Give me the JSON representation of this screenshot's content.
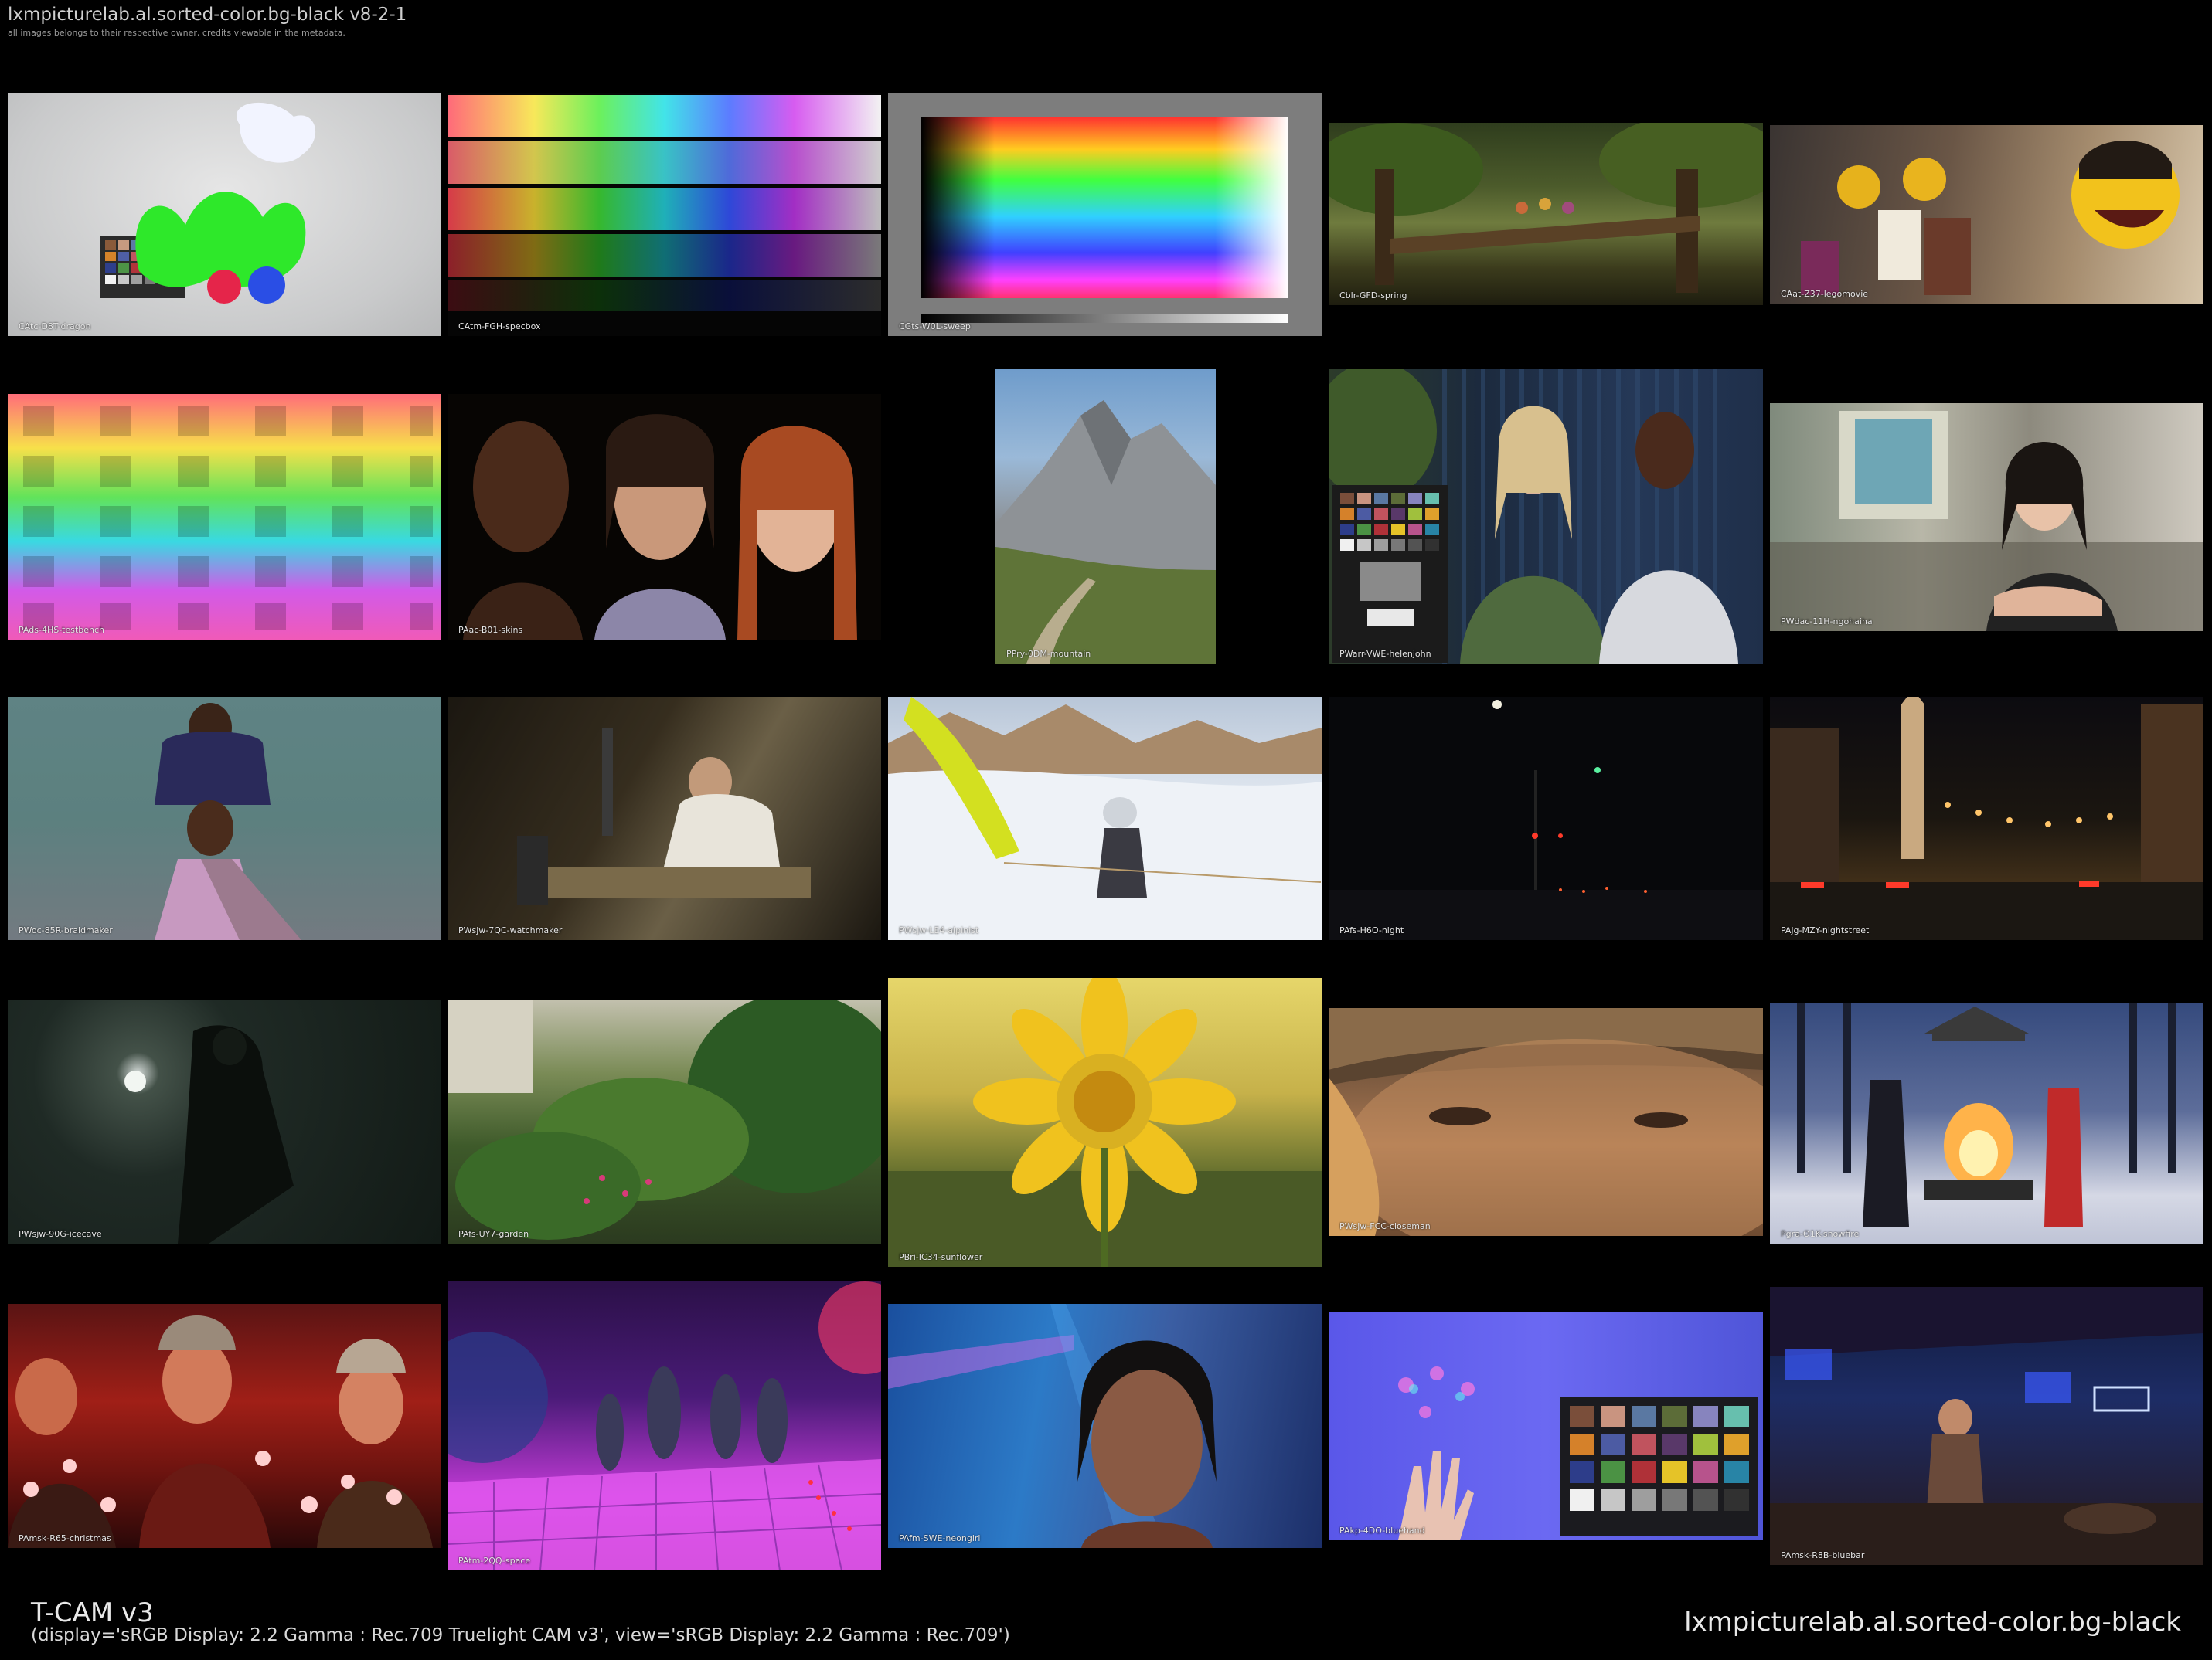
{
  "header": {
    "title": "lxmpicturelab.al.sorted-color.bg-black v8-2-1",
    "subtitle": "all images belongs to their respective owner, credits viewable in the metadata."
  },
  "tiles": [
    {
      "id": "dragon",
      "label": "CAtc-D8T-dragon"
    },
    {
      "id": "specbox",
      "label": "CAtm-FGH-specbox"
    },
    {
      "id": "sweep",
      "label": "CGts-W0L-sweep"
    },
    {
      "id": "spring",
      "label": "Cblr-GFD-spring"
    },
    {
      "id": "lego",
      "label": "CAat-Z37-legomovie"
    },
    {
      "id": "testbench",
      "label": "PAds-4HS-testbench"
    },
    {
      "id": "skins",
      "label": "PAac-B01-skins"
    },
    {
      "id": "mountain",
      "label": "PPry-0DM-mountain"
    },
    {
      "id": "helen",
      "label": "PWarr-VWE-helenjohn"
    },
    {
      "id": "ngo",
      "label": "PWdac-11H-ngohaiha"
    },
    {
      "id": "braid",
      "label": "PWoc-85R-braidmaker"
    },
    {
      "id": "watch",
      "label": "PWsjw-7QC-watchmaker"
    },
    {
      "id": "alpinist",
      "label": "PWsjw-LE4-alpinist"
    },
    {
      "id": "night",
      "label": "PAfs-H6O-night"
    },
    {
      "id": "nightstreet",
      "label": "PAjg-MZY-nightstreet"
    },
    {
      "id": "icecave",
      "label": "PWsjw-90G-icecave"
    },
    {
      "id": "garden",
      "label": "PAfs-UY7-garden"
    },
    {
      "id": "sunflower",
      "label": "PBri-IC34-sunflower"
    },
    {
      "id": "closeman",
      "label": "PWsjw-FCC-closeman"
    },
    {
      "id": "snowfire",
      "label": "Pgra-O1K-snowfire"
    },
    {
      "id": "christmas",
      "label": "PAmsk-R65-christmas"
    },
    {
      "id": "space",
      "label": "PAtm-2QQ-space"
    },
    {
      "id": "neongirl",
      "label": "PAfm-SWE-neongirl"
    },
    {
      "id": "bluehand",
      "label": "PAkp-4DO-bluehand"
    },
    {
      "id": "bluebar",
      "label": "PAmsk-R8B-bluebar"
    }
  ],
  "footer": {
    "look": "T-CAM v3",
    "params": "(display='sRGB Display: 2.2 Gamma : Rec.709 Truelight CAM v3', view='sRGB Display: 2.2 Gamma : Rec.709')",
    "set_name": "lxmpicturelab.al.sorted-color.bg-black"
  },
  "colors": {
    "background": "#000000",
    "text": "#e8e8e8"
  }
}
